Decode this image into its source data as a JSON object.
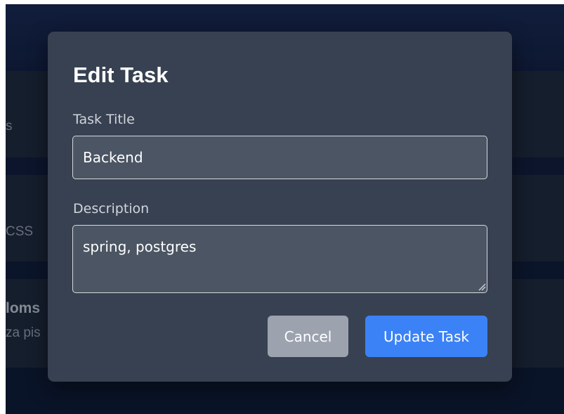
{
  "background": {
    "card1_fragment": "s",
    "card2_fragment": "CSS",
    "card3_title_fragment": "loms",
    "card3_sub_fragment": "za pis"
  },
  "modal": {
    "title": "Edit Task",
    "task_title_label": "Task Title",
    "task_title_value": "Backend",
    "description_label": "Description",
    "description_value": "spring, postgres",
    "cancel_label": "Cancel",
    "update_label": "Update Task"
  },
  "colors": {
    "modal_bg": "#374151",
    "input_bg": "#4b5563",
    "cancel_bg": "#9ca3af",
    "primary": "#3b82f6"
  }
}
